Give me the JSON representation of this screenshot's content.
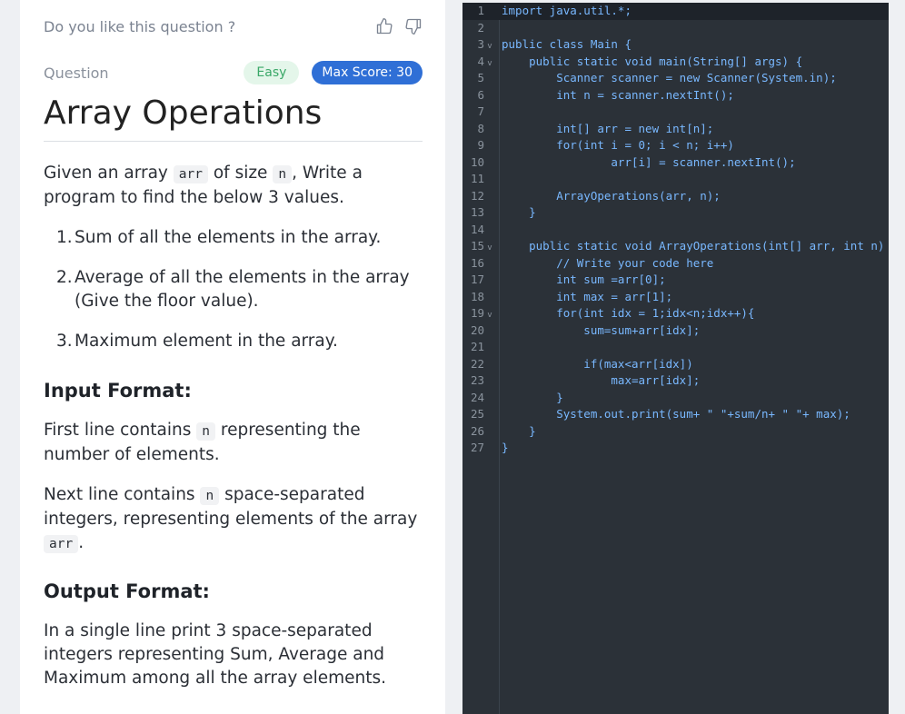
{
  "feedback": {
    "prompt": "Do you like this question ?"
  },
  "question": {
    "label": "Question",
    "difficulty": "Easy",
    "score": "Max Score: 30",
    "title": "Array Operations",
    "intro_a": "Given an array",
    "intro_code_arr": "arr",
    "intro_b": "of size",
    "intro_code_n": "n",
    "intro_c": ", Write a program to find the below 3 values.",
    "items": [
      {
        "num": "1.",
        "text": "Sum of all the elements in the array."
      },
      {
        "num": "2.",
        "text": "Average of all the elements in the array (Give the floor value)."
      },
      {
        "num": "3.",
        "text": "Maximum element in the array."
      }
    ],
    "input_heading": "Input Format:",
    "input_p1_a": "First line contains",
    "input_p1_code": "n",
    "input_p1_b": "representing the number of elements.",
    "input_p2_a": "Next line contains",
    "input_p2_code": "n",
    "input_p2_b": "space-separated integers, representing elements of the array",
    "input_p2_code2": "arr",
    "input_p2_c": ".",
    "output_heading": "Output Format:",
    "output_p": "In a single line print 3 space-separated integers representing Sum, Average and Maximum among all the array elements."
  },
  "editor": {
    "lines": [
      {
        "n": "1",
        "fold": "",
        "text": "import java.util.*;"
      },
      {
        "n": "2",
        "fold": "",
        "text": ""
      },
      {
        "n": "3",
        "fold": "v",
        "text": "public class Main {"
      },
      {
        "n": "4",
        "fold": "v",
        "text": "    public static void main(String[] args) {"
      },
      {
        "n": "5",
        "fold": "",
        "text": "        Scanner scanner = new Scanner(System.in);"
      },
      {
        "n": "6",
        "fold": "",
        "text": "        int n = scanner.nextInt();"
      },
      {
        "n": "7",
        "fold": "",
        "text": ""
      },
      {
        "n": "8",
        "fold": "",
        "text": "        int[] arr = new int[n];"
      },
      {
        "n": "9",
        "fold": "",
        "text": "        for(int i = 0; i < n; i++)"
      },
      {
        "n": "10",
        "fold": "",
        "text": "                arr[i] = scanner.nextInt();"
      },
      {
        "n": "11",
        "fold": "",
        "text": ""
      },
      {
        "n": "12",
        "fold": "",
        "text": "        ArrayOperations(arr, n);"
      },
      {
        "n": "13",
        "fold": "",
        "text": "    }"
      },
      {
        "n": "14",
        "fold": "",
        "text": ""
      },
      {
        "n": "15",
        "fold": "v",
        "text": "    public static void ArrayOperations(int[] arr, int n) {"
      },
      {
        "n": "16",
        "fold": "",
        "text": "        // Write your code here"
      },
      {
        "n": "17",
        "fold": "",
        "text": "        int sum =arr[0];"
      },
      {
        "n": "18",
        "fold": "",
        "text": "        int max = arr[1];"
      },
      {
        "n": "19",
        "fold": "v",
        "text": "        for(int idx = 1;idx<n;idx++){"
      },
      {
        "n": "20",
        "fold": "",
        "text": "            sum=sum+arr[idx];"
      },
      {
        "n": "21",
        "fold": "",
        "text": ""
      },
      {
        "n": "22",
        "fold": "",
        "text": "            if(max<arr[idx])"
      },
      {
        "n": "23",
        "fold": "",
        "text": "                max=arr[idx];"
      },
      {
        "n": "24",
        "fold": "",
        "text": "        }"
      },
      {
        "n": "25",
        "fold": "",
        "text": "        System.out.print(sum+ \" \"+sum/n+ \" \"+ max);"
      },
      {
        "n": "26",
        "fold": "",
        "text": "    }"
      },
      {
        "n": "27",
        "fold": "",
        "text": "}"
      }
    ]
  }
}
